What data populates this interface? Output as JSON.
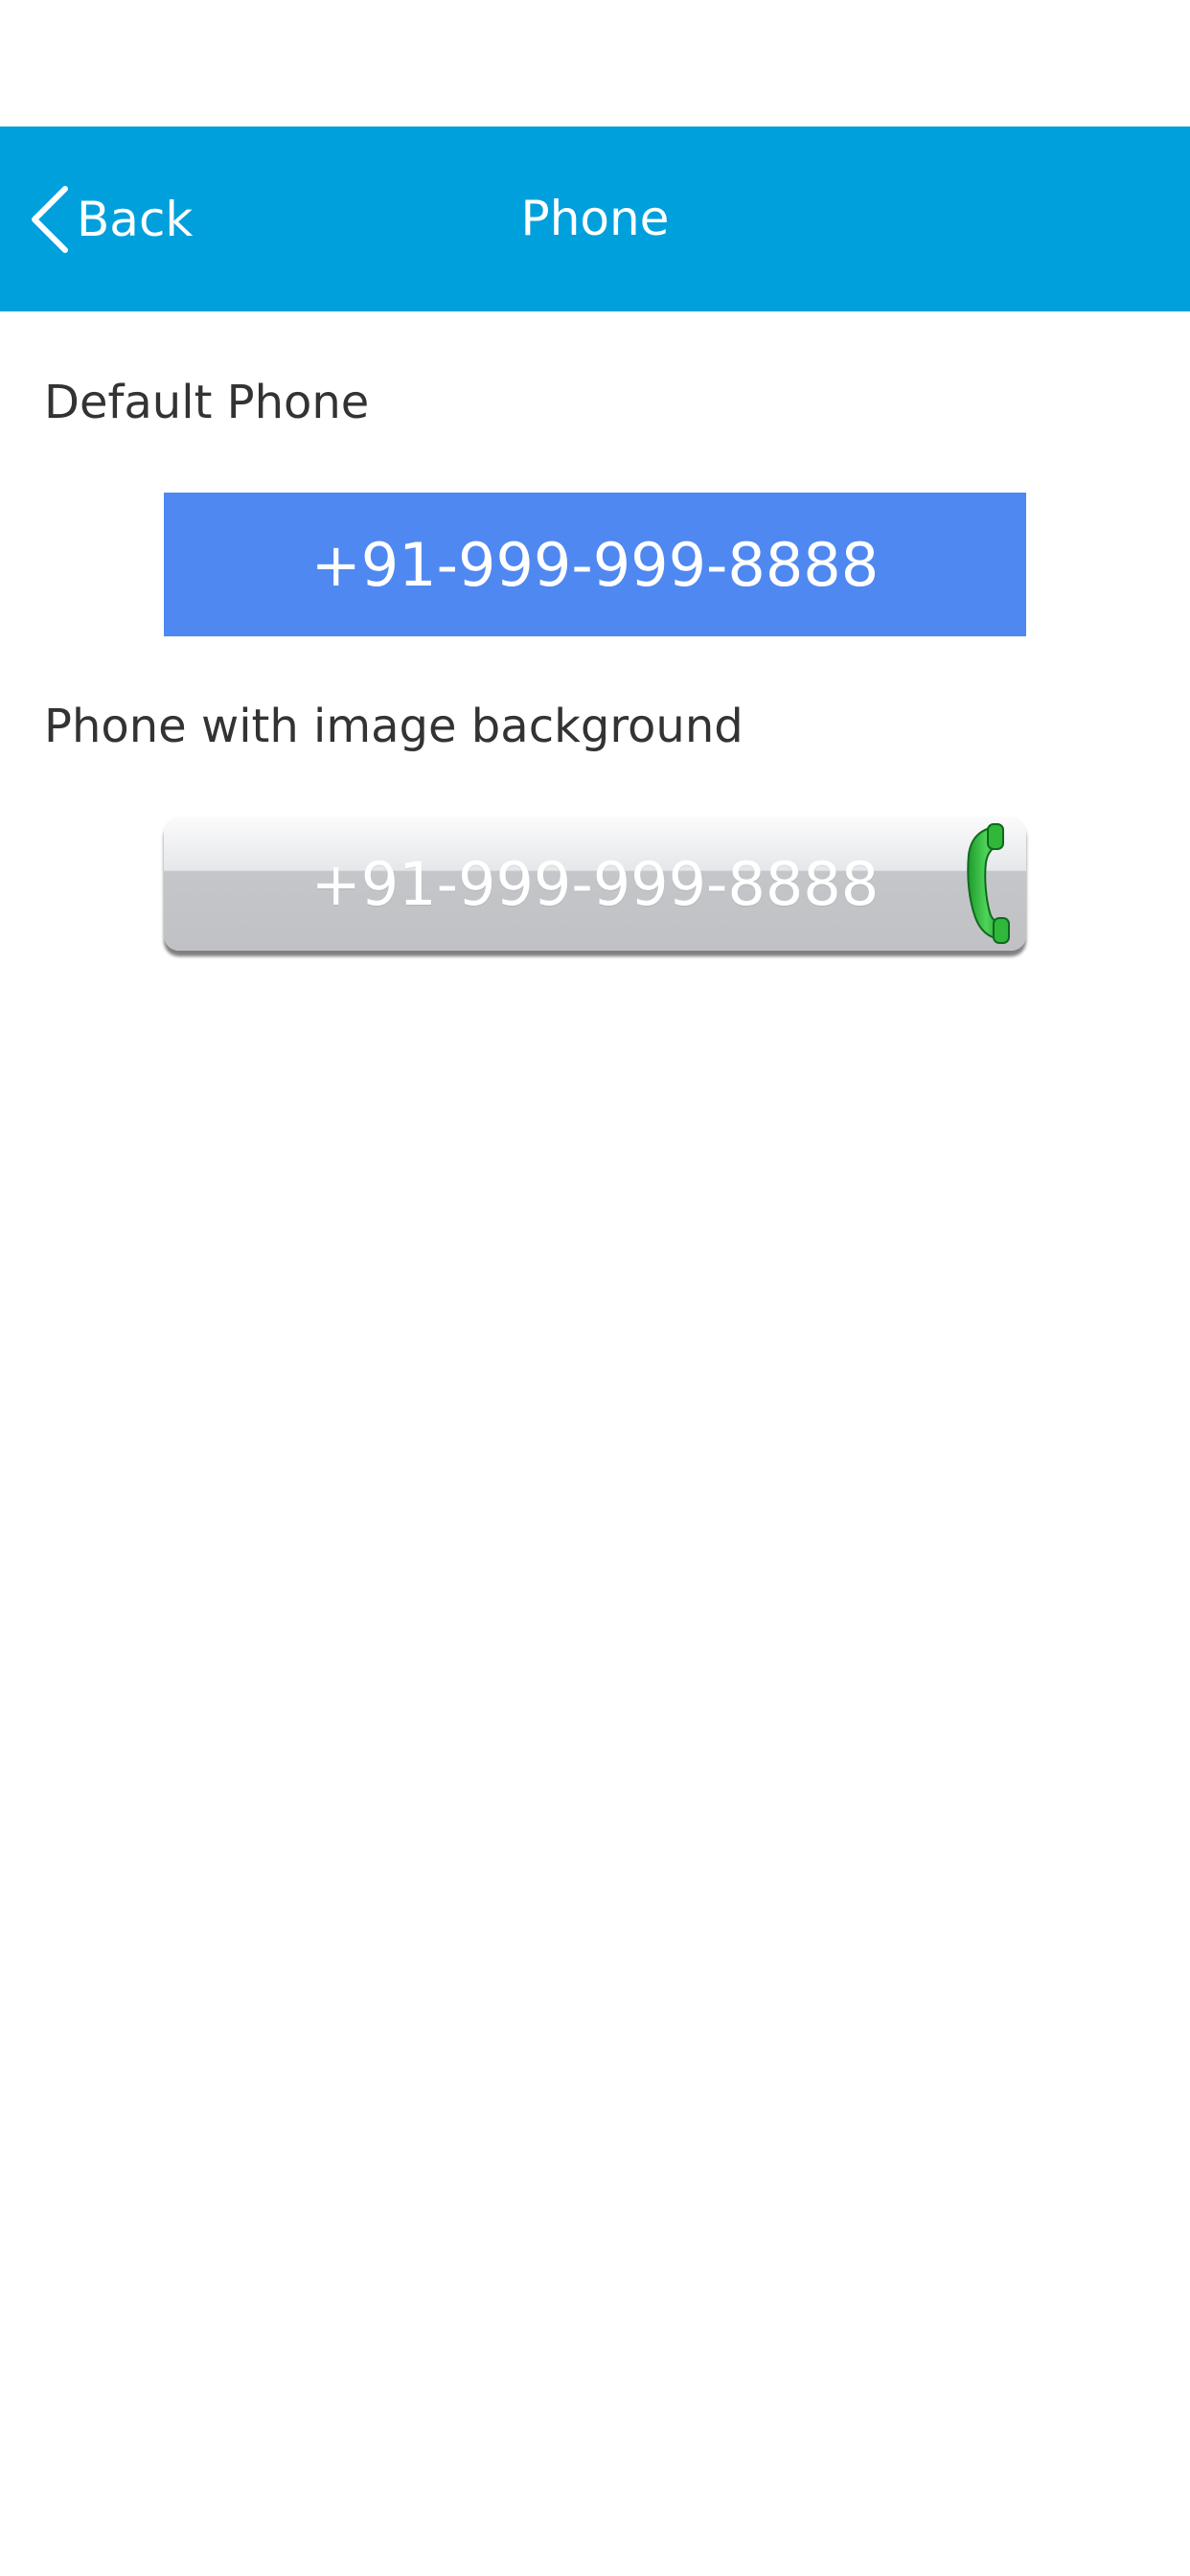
{
  "nav": {
    "back_label": "Back",
    "title": "Phone",
    "background_color": "#00a0dc"
  },
  "sections": {
    "default_label": "Default Phone",
    "default_phone": "+91-999-999-8888",
    "default_button_color": "#4f88f0",
    "image_label": "Phone with image background",
    "image_phone": "+91-999-999-8888"
  },
  "icons": {
    "back": "chevron-left-icon",
    "handset": "phone-handset-icon"
  }
}
